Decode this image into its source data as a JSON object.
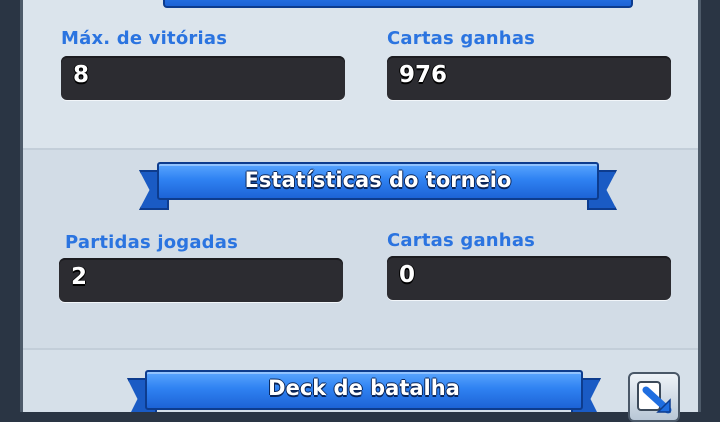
{
  "stats": {
    "max_wins": {
      "label": "Máx. de vitórias",
      "value": "8"
    },
    "cards_won": {
      "label": "Cartas ganhas",
      "value": "976"
    }
  },
  "tournament": {
    "title": "Estatísticas do torneio",
    "matches_played": {
      "label": "Partidas jogadas",
      "value": "2"
    },
    "cards_won": {
      "label": "Cartas ganhas",
      "value": "0"
    }
  },
  "deck": {
    "title": "Deck de batalha",
    "copy_icon": "copy-deck-icon"
  },
  "colors": {
    "label_blue": "#2b74e0",
    "field_dark": "#2c2c31",
    "ribbon_blue": "#2f82f2"
  }
}
